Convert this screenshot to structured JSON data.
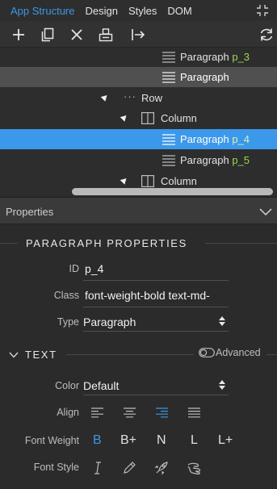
{
  "tabs": [
    "App Structure",
    "Design",
    "Styles",
    "DOM"
  ],
  "tree": {
    "rows": [
      {
        "label": "Paragraph",
        "id": "p_3"
      },
      {
        "label": "Paragraph",
        "id": ""
      },
      {
        "label": "Row",
        "id": ""
      },
      {
        "label": "Column",
        "id": ""
      },
      {
        "label": "Paragraph",
        "id": "p_4"
      },
      {
        "label": "Paragraph",
        "id": "p_5"
      },
      {
        "label": "Column",
        "id": ""
      }
    ]
  },
  "properties": {
    "header": "Properties",
    "section_title": "PARAGRAPH PROPERTIES",
    "id_label": "ID",
    "id_value": "p_4",
    "class_label": "Class",
    "class_value": "font-weight-bold text-md-",
    "type_label": "Type",
    "type_value": "Paragraph"
  },
  "text_section": {
    "title": "TEXT",
    "advanced_label": "Advanced",
    "color_label": "Color",
    "color_value": "Default",
    "align_label": "Align",
    "font_weight_label": "Font Weight",
    "font_weights": [
      "B",
      "B+",
      "N",
      "L",
      "L+"
    ],
    "font_style_label": "Font Style"
  },
  "colors": {
    "accent": "#3d97e6",
    "selected_row": "#3c98ea",
    "id_green": "#9ad84f"
  }
}
